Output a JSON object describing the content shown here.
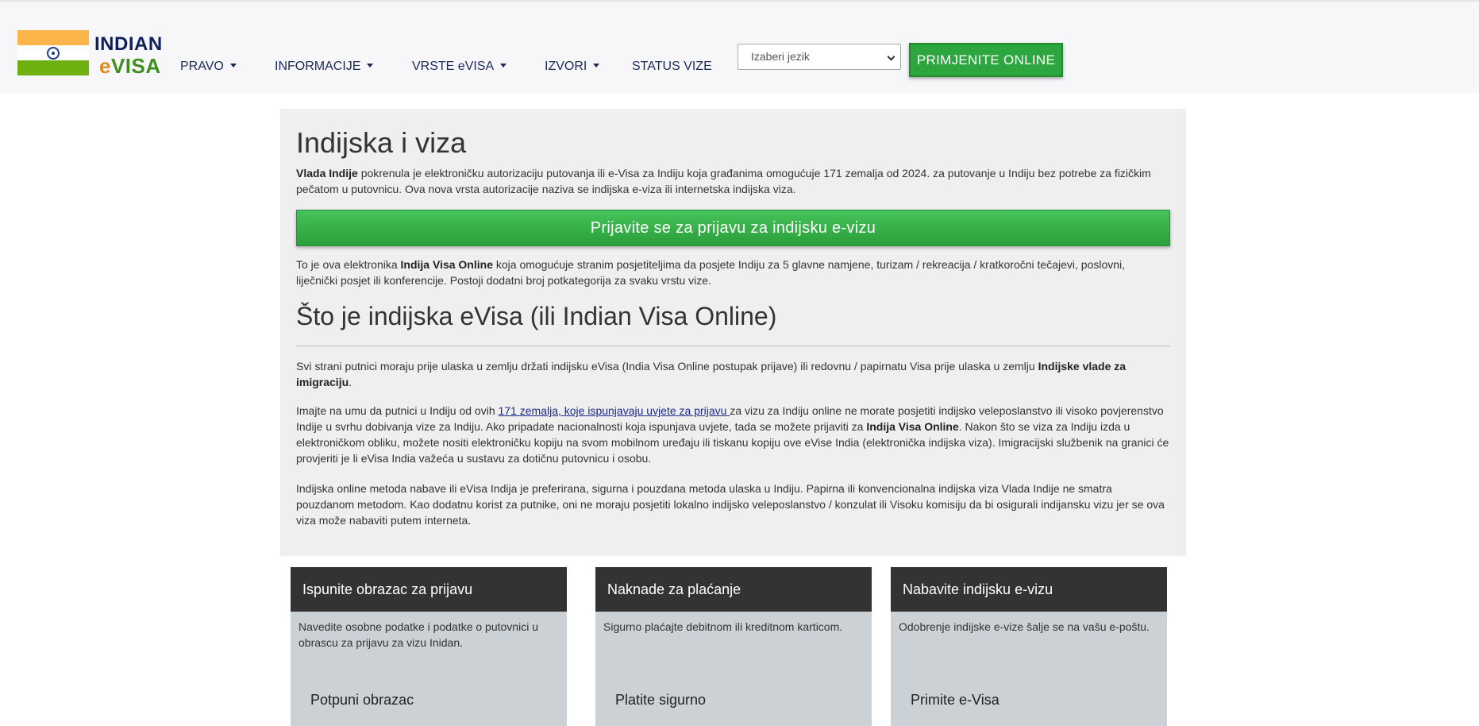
{
  "header": {
    "logo_top": "INDIAN",
    "logo_bottom_e": "e",
    "logo_bottom_rest": "VISA",
    "nav": [
      {
        "label": "PRAVO",
        "dropdown": true
      },
      {
        "label": "INFORMACIJE",
        "dropdown": true
      },
      {
        "label": "VRSTE eVISA",
        "dropdown": true
      },
      {
        "label": "IZVORI",
        "dropdown": true
      },
      {
        "label": "STATUS VIZE",
        "dropdown": false
      }
    ],
    "language_select": {
      "selected": "Izaberi jezik"
    },
    "apply_button": "PRIMJENITE ONLINE",
    "colors": {
      "header_bg": "#f7f7f9",
      "apply_green": "#2ea640",
      "nav_text": "#1b2a59"
    }
  },
  "main": {
    "title": "Indijska i viza",
    "intro": {
      "bold": "Vlada Indije",
      "rest": " pokrenula je elektroničku autorizaciju putovanja ili e-Visa za Indiju koja građanima omogućuje 171 zemalja od 2024. za putovanje u Indiju bez potrebe za fizičkim pečatom u putovnicu. Ova nova vrsta autorizacije naziva se indijska e-viza ili internetska indijska viza."
    },
    "apply_big_button": "Prijavite se za prijavu za indijsku e-vizu",
    "online": {
      "a": "To je ova elektronika ",
      "bold": "Indija Visa Online",
      "b": " koja omogućuje stranim posjetiteljima da posjete Indiju za 5 glavne namjene, turizam / rekreacija / kratkoročni tečajevi, poslovni, liječnički posjet ili konferencije. Postoji dodatni broj potkategorija za svaku vrstu vize."
    },
    "subtitle": "Što je indijska eVisa (ili Indian Visa Online)",
    "travel": {
      "a": "Svi strani putnici moraju prije ulaska u zemlju držati indijsku eVisa (India Visa Online postupak prijave) ili redovnu / papirnatu Visa prije ulaska u zemlju ",
      "bold": "Indijske vlade za imigraciju",
      "b": "."
    },
    "note": {
      "a": "Imajte na umu da putnici u Indiju od ovih ",
      "link": "171 zemalja, koje ispunjavaju uvjete za prijavu ",
      "b": "za vizu za Indiju online ne morate posjetiti indijsko veleposlanstvo ili visoko povjerenstvo Indije u svrhu dobivanja vize za Indiju. Ako pripadate nacionalnosti koja ispunjava uvjete, tada se možete prijaviti za ",
      "bold": "Indija Visa Online",
      "c": ". Nakon što se viza za Indiju izda u elektroničkom obliku, možete nositi elektroničku kopiju na svom mobilnom uređaju ili tiskanu kopiju ove eVise India (elektronička indijska viza). Imigracijski službenik na granici će provjeriti je li eVisa India važeća u sustavu za dotičnu putovnicu i osobu."
    },
    "method": "Indijska online metoda nabave ili eVisa Indija je preferirana, sigurna i pouzdana metoda ulaska u Indiju. Papirna ili konvencionalna indijska viza Vlada Indije ne smatra pouzdanom metodom. Kao dodatnu korist za putnike, oni ne moraju posjetiti lokalno indijsko veleposlanstvo / konzulat ili Visoku komisiju da bi osigurali indijansku vizu jer se ova viza može nabaviti putem interneta."
  },
  "steps": [
    {
      "title": "Ispunite obrazac za prijavu",
      "body": "Navedite osobne podatke i podatke o putovnici u obrascu za prijavu za vizu Inidan.",
      "footer": "Potpuni obrazac"
    },
    {
      "title": "Naknade za plaćanje",
      "body": "Sigurno plaćajte debitnom ili kreditnom karticom.",
      "footer": "Platite sigurno"
    },
    {
      "title": "Nabavite indijsku e-vizu",
      "body": "Odobrenje indijske e-vize šalje se na vašu e-poštu.",
      "footer": "Primite e-Visa"
    }
  ]
}
